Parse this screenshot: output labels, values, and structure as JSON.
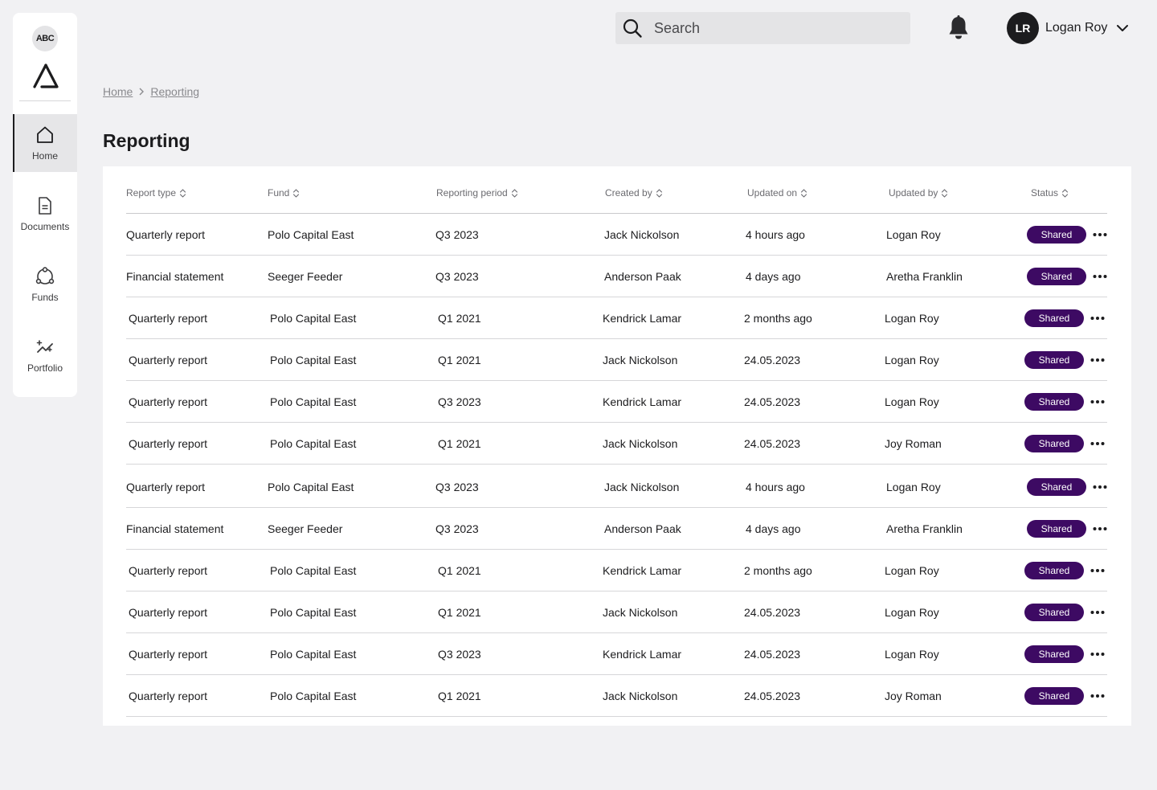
{
  "sidebar": {
    "org_badge": "ABC",
    "logo_icon": "triangle-logo-icon",
    "items": [
      {
        "label": "Home",
        "icon": "home-icon",
        "active": true
      },
      {
        "label": "Documents",
        "icon": "document-icon",
        "active": false
      },
      {
        "label": "Funds",
        "icon": "funds-icon",
        "active": false
      },
      {
        "label": "Portfolio",
        "icon": "portfolio-icon",
        "active": false
      }
    ]
  },
  "header": {
    "search_placeholder": "Search",
    "search_icon": "search-icon",
    "bell_icon": "bell-icon",
    "user": {
      "initials": "LR",
      "name": "Logan Roy",
      "menu_icon": "chevron-down-icon"
    }
  },
  "breadcrumb": {
    "items": [
      "Home",
      "Reporting"
    ]
  },
  "page": {
    "title": "Reporting"
  },
  "table": {
    "columns": [
      "Report type",
      "Fund",
      "Reporting period",
      "Created by",
      "Updated on",
      "Updated by",
      "Status"
    ],
    "rows": [
      [
        "Quarterly report",
        "Polo Capital East",
        "Q3 2023",
        "Jack Nickolson",
        "4 hours ago",
        "Logan Roy",
        "Shared"
      ],
      [
        "Financial statement",
        "Seeger Feeder",
        "Q3 2023",
        "Anderson Paak",
        "4 days ago",
        "Aretha Franklin",
        "Shared"
      ],
      [
        "Quarterly report",
        "Polo Capital East",
        "Q1 2021",
        "Kendrick Lamar",
        "2 months ago",
        "Logan Roy",
        "Shared"
      ],
      [
        "Quarterly report",
        "Polo Capital East",
        "Q1 2021",
        "Jack Nickolson",
        "24.05.2023",
        "Logan Roy",
        "Shared"
      ],
      [
        "Quarterly report",
        "Polo Capital East",
        "Q3 2023",
        "Kendrick Lamar",
        "24.05.2023",
        "Logan Roy",
        "Shared"
      ],
      [
        "Quarterly report",
        "Polo Capital East",
        "Q1 2021",
        "Jack Nickolson",
        "24.05.2023",
        "Joy Roman",
        "Shared"
      ],
      [
        "Quarterly report",
        "Polo Capital East",
        "Q3 2023",
        "Jack Nickolson",
        "4 hours ago",
        "Logan Roy",
        "Shared"
      ],
      [
        "Financial statement",
        "Seeger Feeder",
        "Q3 2023",
        "Anderson Paak",
        "4 days ago",
        "Aretha Franklin",
        "Shared"
      ],
      [
        "Quarterly report",
        "Polo Capital East",
        "Q1 2021",
        "Kendrick Lamar",
        "2 months ago",
        "Logan Roy",
        "Shared"
      ],
      [
        "Quarterly report",
        "Polo Capital East",
        "Q1 2021",
        "Jack Nickolson",
        "24.05.2023",
        "Logan Roy",
        "Shared"
      ],
      [
        "Quarterly report",
        "Polo Capital East",
        "Q3 2023",
        "Kendrick Lamar",
        "24.05.2023",
        "Logan Roy",
        "Shared"
      ],
      [
        "Quarterly report",
        "Polo Capital East",
        "Q1 2021",
        "Jack Nickolson",
        "24.05.2023",
        "Joy Roman",
        "Shared"
      ]
    ]
  },
  "colors": {
    "status_shared": "#3d0a63",
    "background": "#f1f1f3",
    "text": "#1c1c1e"
  }
}
